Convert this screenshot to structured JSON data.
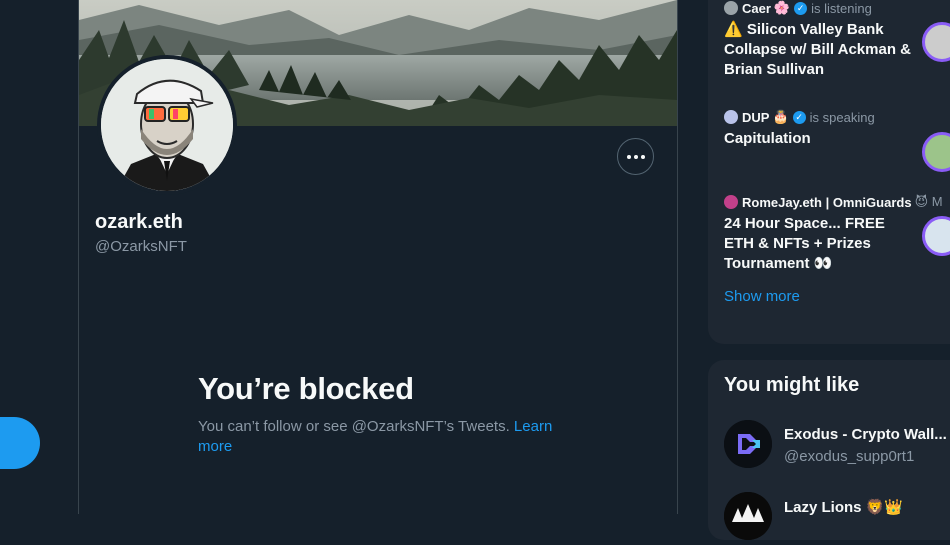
{
  "profile": {
    "display_name": "ozark.eth",
    "handle": "@OzarksNFT",
    "more_label": "More"
  },
  "blocked": {
    "title": "You’re blocked",
    "message": "You can’t follow or see @OzarksNFT’s Tweets. ",
    "learn_more": "Learn more"
  },
  "spaces": {
    "items": [
      {
        "host": "Caer",
        "host_emoji": "🌸",
        "status": "is listening",
        "verified": true,
        "title": "⚠️ Silicon Valley Bank Collapse w/ Bill Ackman & Brian Sullivan"
      },
      {
        "host": "DUP",
        "host_emoji": "🎂",
        "status": "is speaking",
        "verified": true,
        "title": "Capitulation"
      },
      {
        "host": "RomeJay.eth | OmniGuards",
        "host_emoji": "😈 M",
        "status": "",
        "verified": false,
        "title": "24 Hour Space... FREE ETH & NFTs + Prizes Tournament 👀"
      }
    ],
    "show_more": "Show more"
  },
  "who_to_follow": {
    "title": "You might like",
    "items": [
      {
        "name": "Exodus - Crypto Wall...",
        "handle": "@exodus_supp0rt1"
      },
      {
        "name": "Lazy Lions 🦁👑",
        "handle": ""
      }
    ]
  },
  "colors": {
    "background": "#15202b",
    "panel": "#1e2732",
    "accent": "#1d9bf0",
    "secondary_text": "#8b98a5",
    "space_ring": "#8a5cf6"
  }
}
